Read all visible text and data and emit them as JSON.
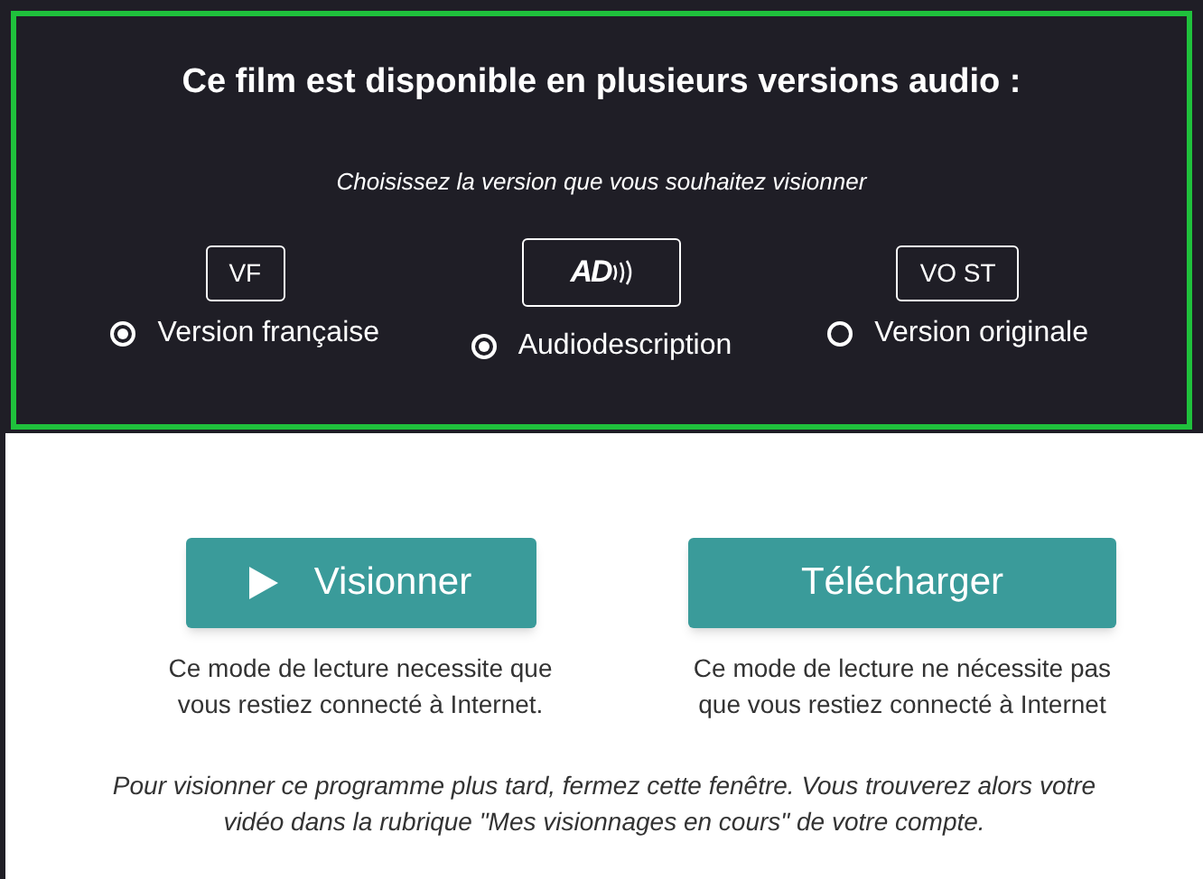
{
  "panel": {
    "title": "Ce film est disponible en plusieurs versions audio :",
    "subtitle": "Choisissez la version que vous souhaitez visionner",
    "versions": [
      {
        "badge": "VF",
        "kind": "text",
        "label": "Version française",
        "selected": true
      },
      {
        "badge": "AD",
        "kind": "audiodescription",
        "label": "Audiodescription",
        "selected": true
      },
      {
        "badge": "VO ST",
        "kind": "text",
        "label": "Version originale",
        "selected": false
      }
    ]
  },
  "actions": [
    {
      "label": "Visionner",
      "kind": "play",
      "note": "Ce mode de lecture necessite que vous restiez connecté à Internet."
    },
    {
      "label": "Télécharger",
      "kind": "plain",
      "note": "Ce mode de lecture ne nécessite pas que vous restiez connecté à Internet"
    }
  ],
  "footer": "Pour visionner ce programme plus tard, fermez cette fenêtre. Vous trouverez alors votre vidéo dans la rubrique \"Mes visionnages en cours\" de votre compte."
}
